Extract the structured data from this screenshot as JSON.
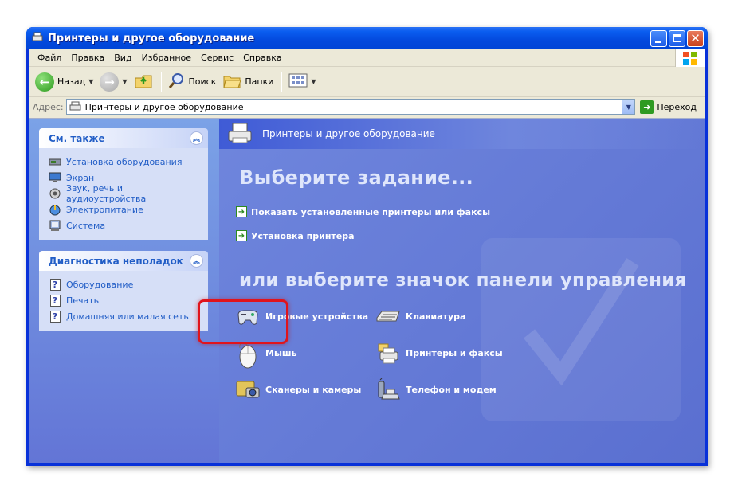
{
  "window": {
    "title": "Принтеры и другое оборудование"
  },
  "menu": [
    "Файл",
    "Правка",
    "Вид",
    "Избранное",
    "Сервис",
    "Справка"
  ],
  "toolbar": {
    "back": "Назад",
    "search": "Поиск",
    "folders": "Папки"
  },
  "address": {
    "label": "Адрес:",
    "value": "Принтеры и другое оборудование",
    "go": "Переход"
  },
  "see_also": {
    "title": "См. также",
    "items": [
      {
        "label": "Установка оборудования",
        "icon": "hardware-icon"
      },
      {
        "label": "Экран",
        "icon": "display-icon"
      },
      {
        "label": "Звук, речь и аудиоустройства",
        "icon": "sound-icon"
      },
      {
        "label": "Электропитание",
        "icon": "power-icon"
      },
      {
        "label": "Система",
        "icon": "system-icon"
      }
    ]
  },
  "troubleshoot": {
    "title": "Диагностика неполадок",
    "items": [
      {
        "label": "Оборудование"
      },
      {
        "label": "Печать"
      },
      {
        "label": "Домашняя или малая сеть"
      }
    ]
  },
  "main": {
    "header": "Принтеры и другое оборудование",
    "task_heading": "Выберите задание...",
    "tasks": [
      "Показать установленные принтеры или факсы",
      "Установка принтера"
    ],
    "or_heading": "или выберите значок панели управления",
    "icons": [
      {
        "label": "Игровые устройства",
        "icon": "gamepad-icon"
      },
      {
        "label": "Клавиатура",
        "icon": "keyboard-icon"
      },
      {
        "label": "Мышь",
        "icon": "mouse-icon"
      },
      {
        "label": "Принтеры и факсы",
        "icon": "printer-icon"
      },
      {
        "label": "Сканеры и камеры",
        "icon": "scanner-icon"
      },
      {
        "label": "Телефон и модем",
        "icon": "phone-icon"
      }
    ]
  },
  "colors": {
    "titlebar": "#0a5df0",
    "taskpane_link": "#215dc6",
    "highlight": "#e0141c"
  }
}
